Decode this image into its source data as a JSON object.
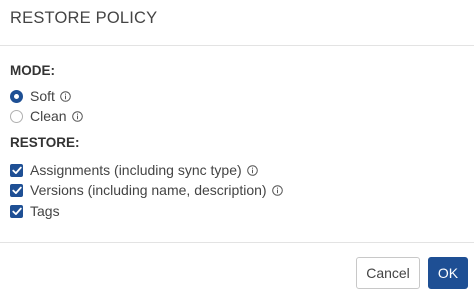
{
  "dialog": {
    "title": "RESTORE POLICY"
  },
  "mode": {
    "label": "MODE:",
    "options": [
      {
        "label": "Soft",
        "selected": true,
        "icon": "info-icon"
      },
      {
        "label": "Clean",
        "selected": false,
        "icon": "info-icon"
      }
    ]
  },
  "restore": {
    "label": "RESTORE:",
    "options": [
      {
        "label": "Assignments (including sync type)",
        "checked": true,
        "icon": "info-icon"
      },
      {
        "label": "Versions (including name, description)",
        "checked": true,
        "icon": "info-icon"
      },
      {
        "label": "Tags",
        "checked": true
      }
    ]
  },
  "footer": {
    "cancel_label": "Cancel",
    "ok_label": "OK"
  },
  "colors": {
    "accent": "#1e4f94",
    "border": "#e3e3e3",
    "text": "#333333"
  }
}
